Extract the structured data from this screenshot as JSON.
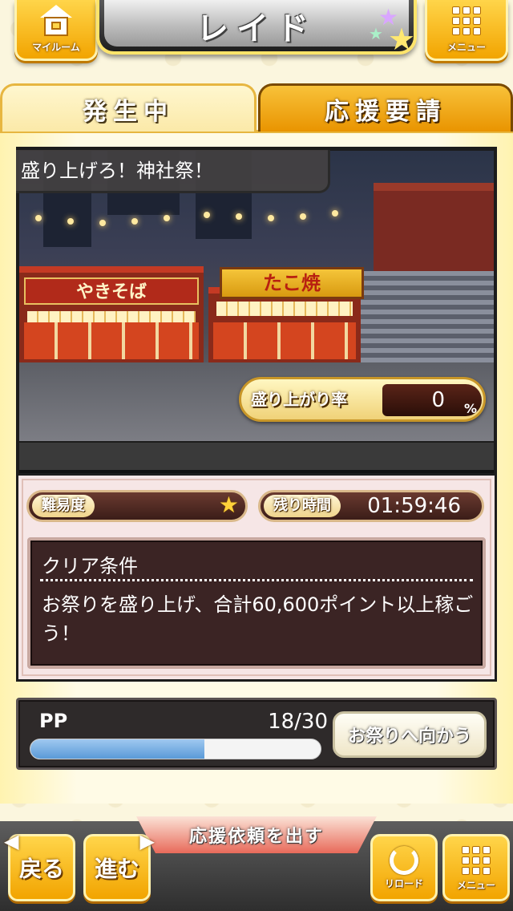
{
  "header": {
    "title": "レイド",
    "myroom_label": "マイルーム",
    "menu_label": "メニュー"
  },
  "tabs": [
    {
      "label": "発生中",
      "active": true
    },
    {
      "label": "応援要請",
      "active": false
    }
  ],
  "event": {
    "title": "盛り上げろ！神社祭！",
    "rate_label": "盛り上がり率",
    "rate_value": "0",
    "rate_unit": "%",
    "stall_sign_left": "やきそば",
    "stall_sign_right": "たこ焼"
  },
  "info": {
    "difficulty_label": "難易度",
    "difficulty_stars": "★",
    "time_label": "残り時間",
    "time_value": "01:59:46",
    "condition_title": "クリア条件",
    "condition_text": "お祭りを盛り上げ、合計60,600ポイント以上稼ごう！"
  },
  "pp": {
    "label": "PP",
    "count": "18/30",
    "current": 18,
    "max": 30,
    "go_button": "お祭りへ向かう"
  },
  "footer": {
    "request_banner": "応援依頼を出す",
    "back_label": "戻る",
    "forward_label": "進む",
    "reload_label": "リロード",
    "menu_label": "メニュー"
  },
  "colors": {
    "accent": "#f2a400",
    "panel_dark": "#3b2424",
    "pp_fill": "#5a9ad8"
  }
}
